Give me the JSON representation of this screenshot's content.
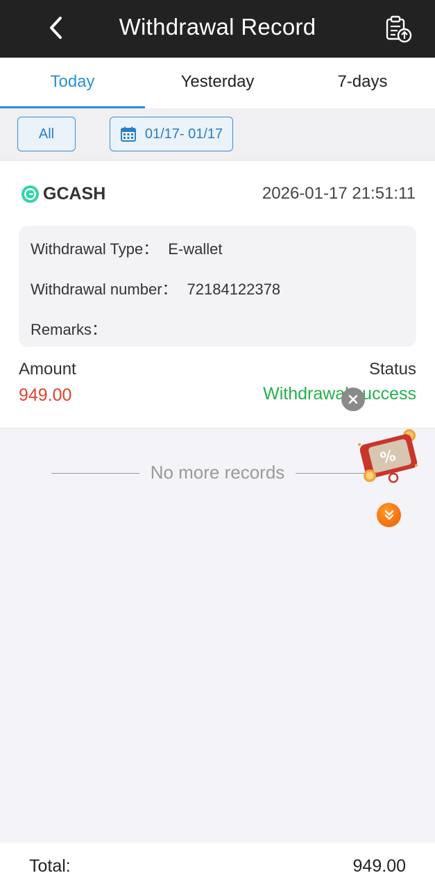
{
  "header": {
    "title": "Withdrawal Record",
    "back_icon": "chevron-left-icon",
    "action_icon": "clipboard-upload-icon"
  },
  "tabs": [
    {
      "label": "Today",
      "active": true
    },
    {
      "label": "Yesterday",
      "active": false
    },
    {
      "label": "7-days",
      "active": false
    }
  ],
  "filters": {
    "all_label": "All",
    "date_range": "01/17- 01/17",
    "date_icon": "calendar-icon"
  },
  "record": {
    "provider": "GCASH",
    "timestamp": "2026-01-17 21:51:11",
    "type_label": "Withdrawal Type：",
    "type_value": "E-wallet",
    "number_label": "Withdrawal number：",
    "number_value": "72184122378",
    "remarks_label": "Remarks：",
    "remarks_value": "",
    "amount_label": "Amount",
    "amount_value": "949.00",
    "status_label": "Status",
    "status_value": "Withdrawal success"
  },
  "list_end_text": "No more records",
  "footer": {
    "total_label": "Total:",
    "total_value": "949.00"
  },
  "colors": {
    "header_bg": "#222222",
    "accent": "#2a8fd6",
    "amount": "#e0422c",
    "status_success": "#22b14c",
    "gcash_logo": "#2fd6a6"
  }
}
